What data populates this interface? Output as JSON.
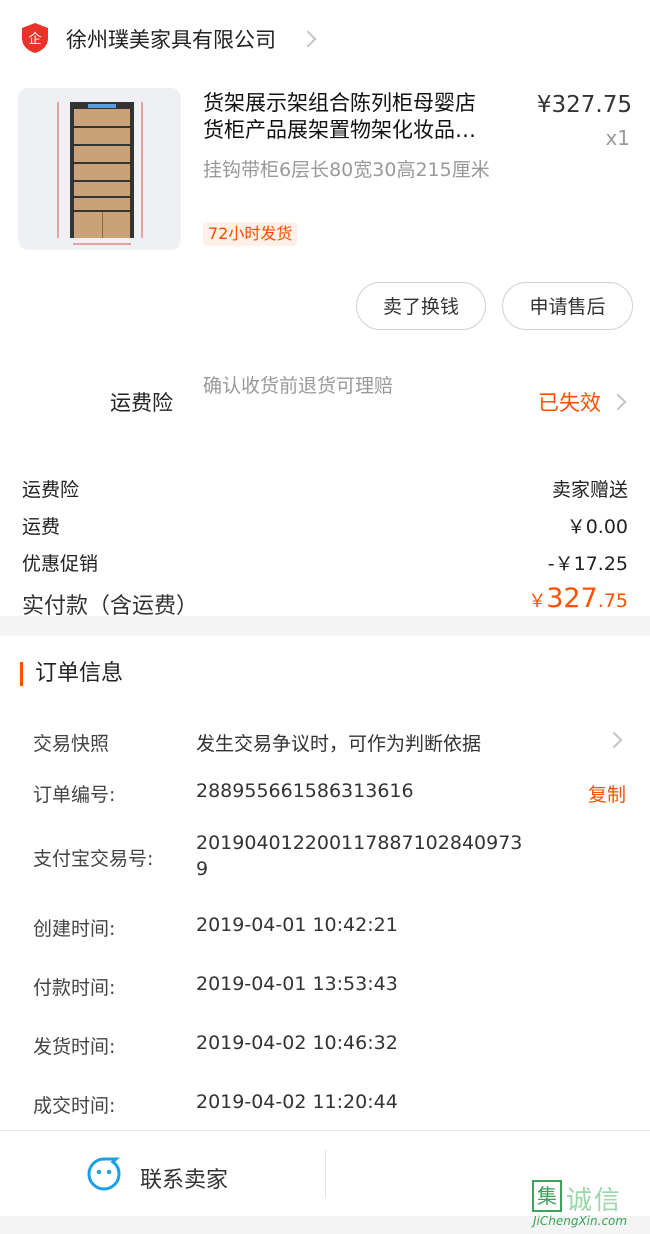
{
  "shop": {
    "name": "徐州璞美家具有限公司",
    "icon": "enterprise-badge-icon",
    "badge_text": "企"
  },
  "product": {
    "title_line1": "货架展示架组合陈列柜母婴店",
    "title_line2": "货柜产品展架置物架化妆品…",
    "spec": "挂钩带柜6层长80宽30高215厘米",
    "price": "¥327.75",
    "quantity": "x1",
    "tag": "72小时发货"
  },
  "actions": {
    "resell": "卖了换钱",
    "after_sale": "申请售后"
  },
  "insurance": {
    "label": "运费险",
    "desc": "确认收货前退货可理赔",
    "status": "已失效"
  },
  "summary": {
    "rows": [
      {
        "label": "运费险",
        "value": "卖家赠送"
      },
      {
        "label": "运费",
        "value": "￥0.00"
      },
      {
        "label": "优惠促销",
        "value": "-￥17.25"
      }
    ],
    "paid_label": "实付款（含运费）",
    "paid_currency": "￥",
    "paid_int": "327",
    "paid_dec": ".75"
  },
  "order_info": {
    "title": "订单信息",
    "snapshot_label": "交易快照",
    "snapshot_value": "发生交易争议时，可作为判断依据",
    "order_no_label": "订单编号:",
    "order_no": "288955661586313616",
    "copy": "复制",
    "alipay_label": "支付宝交易号:",
    "alipay_no_line1": "201904012200117887102840973",
    "alipay_no_line2": "9",
    "created_label": "创建时间:",
    "created": "2019-04-01 10:42:21",
    "paid_label": "付款时间:",
    "paid": "2019-04-01 13:53:43",
    "shipped_label": "发货时间:",
    "shipped": "2019-04-02 10:46:32",
    "closed_label": "成交时间:",
    "closed": "2019-04-02 11:20:44"
  },
  "bottom": {
    "contact": "联系卖家",
    "contact_icon": "chat-smile-icon"
  },
  "watermark": {
    "box": "集",
    "text": "诚信",
    "url": "JiChengXin.com"
  },
  "colors": {
    "accent": "#ff5000",
    "muted": "#999999"
  }
}
